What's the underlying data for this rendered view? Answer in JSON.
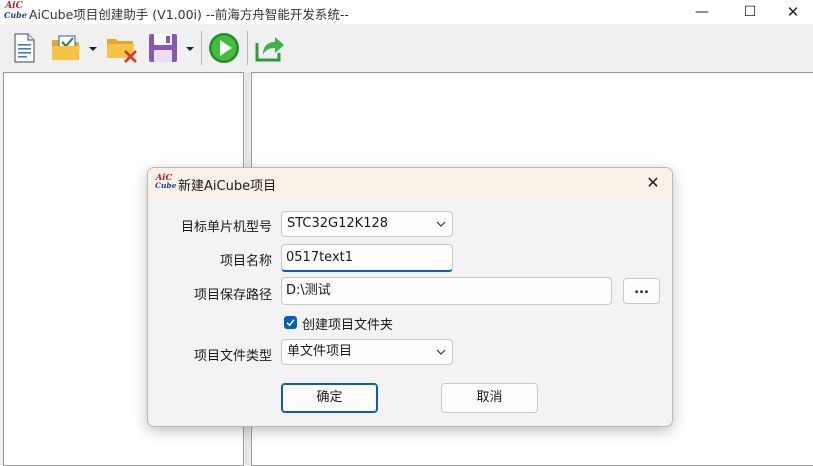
{
  "window": {
    "title": "AiCube项目创建助手 (V1.00i) --前海方舟智能开发系统--",
    "logo_line1": "AiC",
    "logo_line2": "Cube",
    "minimize": "—",
    "maximize": "☐",
    "close": "✕"
  },
  "toolbar": {
    "buttons": [
      {
        "icon": "new-document-icon"
      },
      {
        "icon": "open-folder-icon",
        "has_dropdown": true
      },
      {
        "icon": "close-project-icon"
      },
      {
        "icon": "save-icon",
        "has_dropdown": true
      },
      {
        "icon": "run-icon"
      },
      {
        "icon": "export-icon"
      }
    ]
  },
  "dialog": {
    "title": "新建AiCube项目",
    "logo_line1": "AiC",
    "logo_line2": "Cube",
    "close": "✕",
    "fields": {
      "mcu_model_label": "目标单片机型号",
      "mcu_model_value": "STC32G12K128",
      "project_name_label": "项目名称",
      "project_name_value": "0517text1",
      "save_path_label": "项目保存路径",
      "save_path_value": "D:\\测试",
      "browse_label": "...",
      "create_folder_label": "创建项目文件夹",
      "create_folder_checked": true,
      "file_type_label": "项目文件类型",
      "file_type_value": "单文件项目"
    },
    "ok_label": "确定",
    "cancel_label": "取消"
  },
  "colors": {
    "accent": "#0a5cc4",
    "dialog_title_bg": "#f9f0e7",
    "logo_red": "#c0202a",
    "logo_blue": "#1c3f9a"
  }
}
